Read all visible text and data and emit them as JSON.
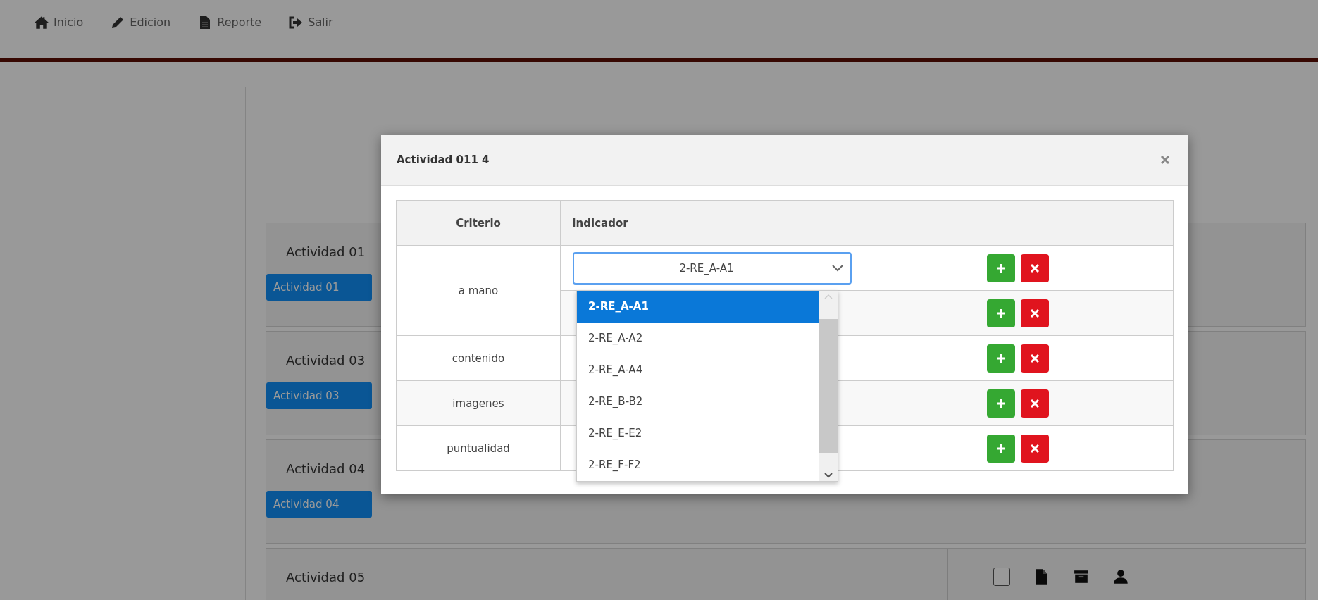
{
  "nav": [
    {
      "label": "Inicio"
    },
    {
      "label": "Edicion"
    },
    {
      "label": "Reporte"
    },
    {
      "label": "Salir"
    }
  ],
  "activities": [
    {
      "label": "Actividad 01",
      "button": "Actividad 01"
    },
    {
      "label": "Actividad 03",
      "button": "Actividad 03"
    },
    {
      "label": "Actividad 04",
      "button": "Actividad 04"
    }
  ],
  "last_activity": {
    "label": "Actividad 05",
    "checked": false
  },
  "modal": {
    "title": "Actividad 011 4",
    "columns": [
      "Criterio",
      "Indicador"
    ],
    "criteria": [
      {
        "name": "a mano",
        "rows": [
          {
            "kind": "select",
            "value": "2-RE_A-A1"
          },
          {
            "kind": "covered"
          }
        ]
      },
      {
        "name": "contenido",
        "rows": [
          {
            "kind": "covered"
          }
        ]
      },
      {
        "name": "imagenes",
        "rows": [
          {
            "kind": "covered"
          }
        ]
      },
      {
        "name": "puntualidad",
        "rows": [
          {
            "kind": "covered"
          }
        ]
      }
    ],
    "dropdown": {
      "options": [
        {
          "label": "2-RE_A-A1",
          "selected": true
        },
        {
          "label": "2-RE_A-A2",
          "selected": false
        },
        {
          "label": "2-RE_A-A4",
          "selected": false
        },
        {
          "label": "2-RE_B-B2",
          "selected": false
        },
        {
          "label": "2-RE_E-E2",
          "selected": false
        },
        {
          "label": "2-RE_F-F2",
          "selected": false
        }
      ]
    }
  }
}
